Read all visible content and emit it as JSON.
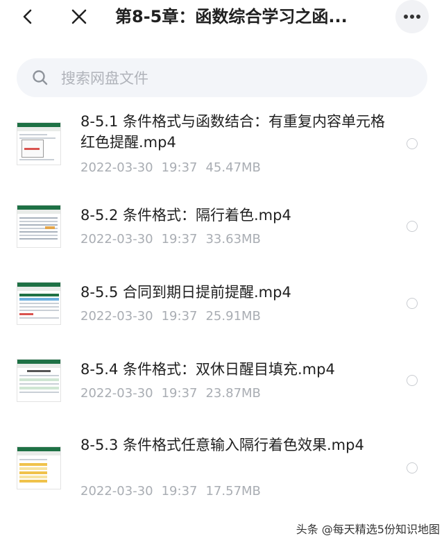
{
  "header": {
    "title": "第8-5章：函数综合学习之函..."
  },
  "search": {
    "placeholder": "搜索网盘文件"
  },
  "files": [
    {
      "name": "8-5.1 条件格式与函数结合：有重复内容单元格红色提醒.mp4",
      "date": "2022-03-30",
      "time": "19:37",
      "size": "45.47MB"
    },
    {
      "name": "8-5.2 条件格式：隔行着色.mp4",
      "date": "2022-03-30",
      "time": "19:37",
      "size": "33.63MB"
    },
    {
      "name": "8-5.5 合同到期日提前提醒.mp4",
      "date": "2022-03-30",
      "time": "19:37",
      "size": "25.91MB"
    },
    {
      "name": "8-5.4 条件格式：双休日醒目填充.mp4",
      "date": "2022-03-30",
      "time": "19:37",
      "size": "23.87MB"
    },
    {
      "name": "8-5.3 条件格式任意输入隔行着色效果.mp4",
      "date": "2022-03-30",
      "time": "19:37",
      "size": "17.57MB"
    }
  ],
  "watermark": "头条 @每天精选5份知识地图",
  "colors": {
    "excel_green": "#1e7145",
    "meta_gray": "#a9adb3",
    "search_bg": "#f3f5f9"
  },
  "icons": [
    "back-arrow-icon",
    "close-icon",
    "more-dots-icon",
    "search-icon",
    "video-thumbnail",
    "radio-icon"
  ]
}
